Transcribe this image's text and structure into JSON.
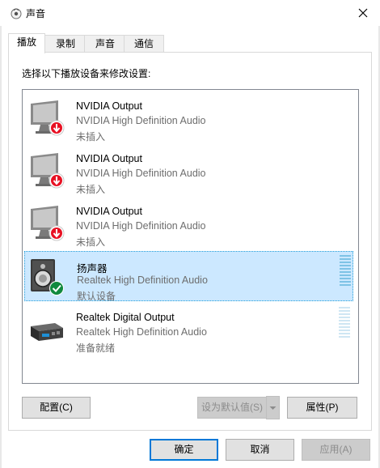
{
  "window": {
    "title": "声音",
    "close_glyph": "✕"
  },
  "tabs": [
    {
      "label": "播放",
      "active": true
    },
    {
      "label": "录制",
      "active": false
    },
    {
      "label": "声音",
      "active": false
    },
    {
      "label": "通信",
      "active": false
    }
  ],
  "instruction": "选择以下播放设备来修改设置:",
  "devices": [
    {
      "name": "NVIDIA Output",
      "driver": "NVIDIA High Definition Audio",
      "status": "未插入",
      "icon": "monitor-icon",
      "badge": "unplugged-arrow-icon",
      "selected": false
    },
    {
      "name": "NVIDIA Output",
      "driver": "NVIDIA High Definition Audio",
      "status": "未插入",
      "icon": "monitor-icon",
      "badge": "unplugged-arrow-icon",
      "selected": false
    },
    {
      "name": "NVIDIA Output",
      "driver": "NVIDIA High Definition Audio",
      "status": "未插入",
      "icon": "monitor-icon",
      "badge": "unplugged-arrow-icon",
      "selected": false
    },
    {
      "name": "扬声器",
      "driver": "Realtek High Definition Audio",
      "status": "默认设备",
      "icon": "speaker-icon",
      "badge": "default-check-icon",
      "selected": true
    },
    {
      "name": "Realtek Digital Output",
      "driver": "Realtek High Definition Audio",
      "status": "准备就绪",
      "icon": "digital-output-icon",
      "badge": "",
      "selected": false
    }
  ],
  "buttons": {
    "configure": "配置(C)",
    "set_default": "设为默认值(S)",
    "properties": "属性(P)",
    "ok": "确定",
    "cancel": "取消",
    "apply": "应用(A)"
  },
  "colors": {
    "selection": "#cce8ff",
    "selection_border": "#26a0da",
    "meter_active": "#7ec3e6",
    "meter_idle": "#cfe6f3",
    "badge_red": "#e81123",
    "badge_green": "#10893e"
  }
}
